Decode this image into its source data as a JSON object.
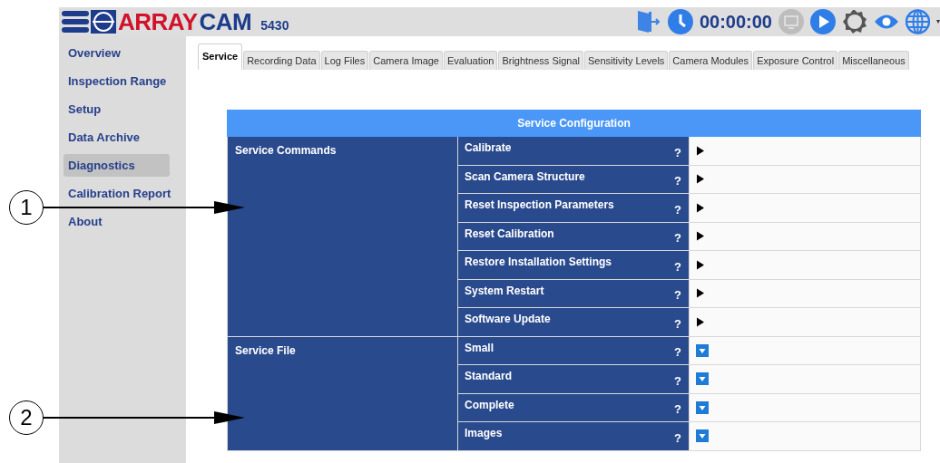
{
  "header": {
    "logo_a": "ARRAY",
    "logo_b": "CAM",
    "model": "5430",
    "timer": "00:00:00"
  },
  "sidebar": {
    "items": [
      {
        "label": "Overview",
        "selected": false
      },
      {
        "label": "Inspection Range",
        "selected": false
      },
      {
        "label": "Setup",
        "selected": false
      },
      {
        "label": "Data Archive",
        "selected": false
      },
      {
        "label": "Diagnostics",
        "selected": true
      },
      {
        "label": "Calibration Report",
        "selected": false
      },
      {
        "label": "About",
        "selected": false
      }
    ]
  },
  "tabs": [
    {
      "label": "Service",
      "selected": true
    },
    {
      "label": "Recording Data",
      "selected": false
    },
    {
      "label": "Log Files",
      "selected": false
    },
    {
      "label": "Camera Image",
      "selected": false
    },
    {
      "label": "Evaluation",
      "selected": false
    },
    {
      "label": "Brightness Signal",
      "selected": false
    },
    {
      "label": "Sensitivity Levels",
      "selected": false
    },
    {
      "label": "Camera Modules",
      "selected": false
    },
    {
      "label": "Exposure Control",
      "selected": false
    },
    {
      "label": "Miscellaneous",
      "selected": false
    }
  ],
  "table": {
    "title": "Service Configuration",
    "groups": [
      {
        "name": "Service Commands",
        "rows": [
          {
            "label": "Calibrate",
            "help": "?",
            "kind": "run"
          },
          {
            "label": "Scan Camera Structure",
            "help": "?",
            "kind": "run"
          },
          {
            "label": "Reset Inspection Parameters",
            "help": "?",
            "kind": "run"
          },
          {
            "label": "Reset Calibration",
            "help": "?",
            "kind": "run"
          },
          {
            "label": "Restore Installation Settings",
            "help": "?",
            "kind": "run"
          },
          {
            "label": "System Restart",
            "help": "?",
            "kind": "run"
          },
          {
            "label": "Software Update",
            "help": "?",
            "kind": "run"
          }
        ]
      },
      {
        "name": "Service File",
        "rows": [
          {
            "label": "Small",
            "help": "?",
            "kind": "select"
          },
          {
            "label": "Standard",
            "help": "?",
            "kind": "select"
          },
          {
            "label": "Complete",
            "help": "?",
            "kind": "select"
          },
          {
            "label": "Images",
            "help": "?",
            "kind": "select"
          }
        ]
      }
    ]
  },
  "callouts": [
    {
      "label": "1"
    },
    {
      "label": "2"
    }
  ]
}
